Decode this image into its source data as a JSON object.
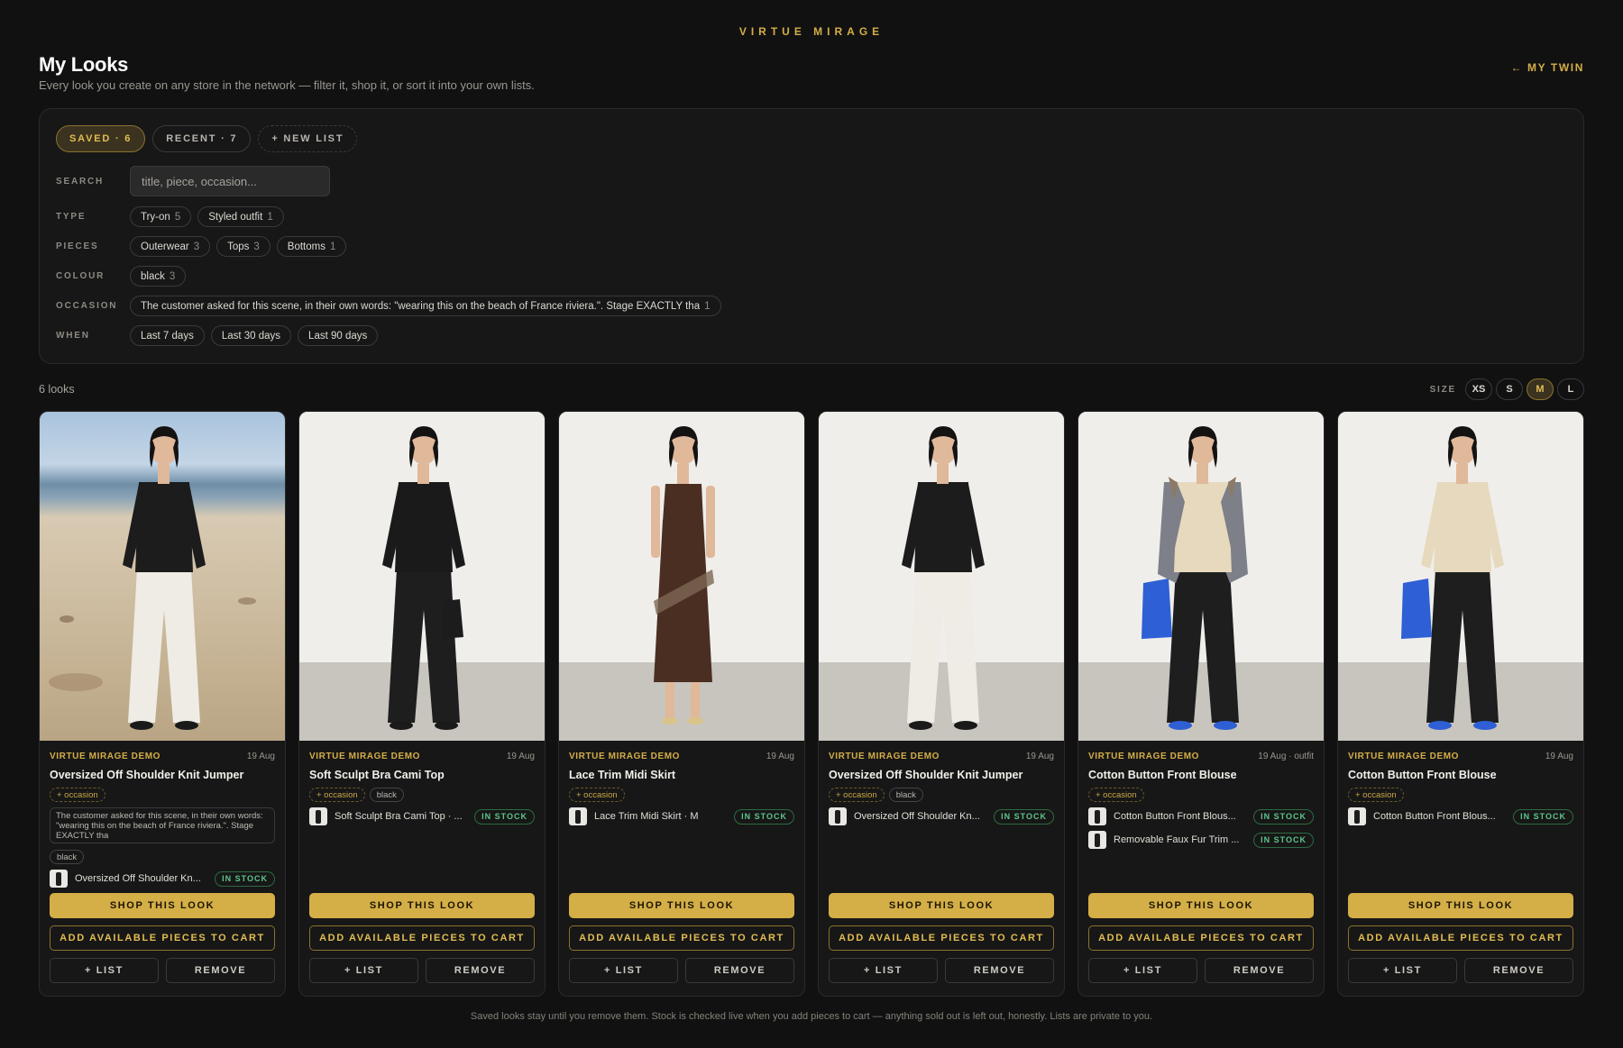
{
  "brand": "VIRTUE MIRAGE",
  "header": {
    "title": "My Looks",
    "subtitle": "Every look you create on any store in the network — filter it, shop it, or sort it into your own lists.",
    "back_link": "← MY TWIN"
  },
  "tabs": [
    {
      "label": "SAVED · 6",
      "active": true
    },
    {
      "label": "RECENT · 7",
      "active": false
    },
    {
      "label": "+ NEW LIST",
      "active": false
    }
  ],
  "filters": {
    "search": {
      "label": "SEARCH",
      "placeholder": "title, piece, occasion...",
      "value": ""
    },
    "type": {
      "label": "TYPE",
      "chips": [
        {
          "name": "Try-on",
          "count": "5"
        },
        {
          "name": "Styled outfit",
          "count": "1"
        }
      ]
    },
    "pieces": {
      "label": "PIECES",
      "chips": [
        {
          "name": "Outerwear",
          "count": "3"
        },
        {
          "name": "Tops",
          "count": "3"
        },
        {
          "name": "Bottoms",
          "count": "1"
        }
      ]
    },
    "colour": {
      "label": "COLOUR",
      "chips": [
        {
          "name": "black",
          "count": "3"
        }
      ]
    },
    "occasion": {
      "label": "OCCASION",
      "chips": [
        {
          "name": "The customer asked for this scene, in their own words: \"wearing this on the beach of France riviera.\". Stage EXACTLY tha",
          "count": "1"
        }
      ]
    },
    "when": {
      "label": "WHEN",
      "chips": [
        {
          "name": "Last 7 days",
          "count": ""
        },
        {
          "name": "Last 30 days",
          "count": ""
        },
        {
          "name": "Last 90 days",
          "count": ""
        }
      ]
    }
  },
  "results": {
    "count_label": "6 looks"
  },
  "size_selector": {
    "label": "SIZE",
    "options": [
      "XS",
      "S",
      "M",
      "L"
    ],
    "selected": "M"
  },
  "labels": {
    "occasion_tag": "+ occasion",
    "in_stock": "IN STOCK",
    "shop": "SHOP THIS LOOK",
    "add": "ADD AVAILABLE PIECES TO CART",
    "list": "+ LIST",
    "remove": "REMOVE"
  },
  "cards": [
    {
      "store": "VIRTUE MIRAGE DEMO",
      "date": "19 Aug",
      "title": "Oversized Off Shoulder Knit Jumper",
      "occasion_note": "The customer asked for this scene, in their own words: \"wearing this on the beach of France riviera.\". Stage EXACTLY tha",
      "colour_tag": "black",
      "pieces": [
        {
          "name": "Oversized Off Shoulder Kn...",
          "stock": "IN STOCK"
        }
      ],
      "scene": "beach",
      "top_color": "#1c1c1c",
      "bottom_color": "#efece6",
      "bag": false,
      "jacket": ""
    },
    {
      "store": "VIRTUE MIRAGE DEMO",
      "date": "19 Aug",
      "title": "Soft Sculpt Bra Cami Top",
      "occasion_note": "",
      "colour_tag": "black",
      "pieces": [
        {
          "name": "Soft Sculpt Bra Cami Top · ...",
          "stock": "IN STOCK"
        }
      ],
      "scene": "studio",
      "top_color": "#1a1a1a",
      "bottom_color": "#1e1e1e",
      "bag": "black",
      "jacket": ""
    },
    {
      "store": "VIRTUE MIRAGE DEMO",
      "date": "19 Aug",
      "title": "Lace Trim Midi Skirt",
      "occasion_note": "",
      "colour_tag": "",
      "pieces": [
        {
          "name": "Lace Trim Midi Skirt · M",
          "stock": "IN STOCK"
        }
      ],
      "scene": "studio",
      "top_color": "#4a2e22",
      "bottom_color": "#4a2e22",
      "bag": false,
      "jacket": "",
      "dress": true
    },
    {
      "store": "VIRTUE MIRAGE DEMO",
      "date": "19 Aug",
      "title": "Oversized Off Shoulder Knit Jumper",
      "occasion_note": "",
      "colour_tag": "black",
      "pieces": [
        {
          "name": "Oversized Off Shoulder Kn...",
          "stock": "IN STOCK"
        }
      ],
      "scene": "studio",
      "top_color": "#1c1c1c",
      "bottom_color": "#efece6",
      "bag": false,
      "jacket": ""
    },
    {
      "store": "VIRTUE MIRAGE DEMO",
      "date": "19 Aug · outfit",
      "title": "Cotton Button Front Blouse",
      "occasion_note": "",
      "colour_tag": "",
      "pieces": [
        {
          "name": "Cotton Button Front Blous...",
          "stock": "IN STOCK"
        },
        {
          "name": "Removable Faux Fur Trim ...",
          "stock": "IN STOCK"
        }
      ],
      "scene": "studio",
      "top_color": "#e6d9bd",
      "bottom_color": "#1e1e1e",
      "bag": "blue",
      "jacket": "#7d8088"
    },
    {
      "store": "VIRTUE MIRAGE DEMO",
      "date": "19 Aug",
      "title": "Cotton Button Front Blouse",
      "occasion_note": "",
      "colour_tag": "",
      "pieces": [
        {
          "name": "Cotton Button Front Blous...",
          "stock": "IN STOCK"
        }
      ],
      "scene": "studio",
      "top_color": "#e6d9bd",
      "bottom_color": "#1e1e1e",
      "bag": "blue",
      "jacket": ""
    }
  ],
  "footer": "Saved looks stay until you remove them. Stock is checked live when you add pieces to cart — anything sold out is left out, honestly. Lists are private to you.",
  "colors": {
    "accent": "#d4ae47",
    "background": "#111111",
    "panel": "#171717",
    "in_stock": "#5dc48a"
  }
}
